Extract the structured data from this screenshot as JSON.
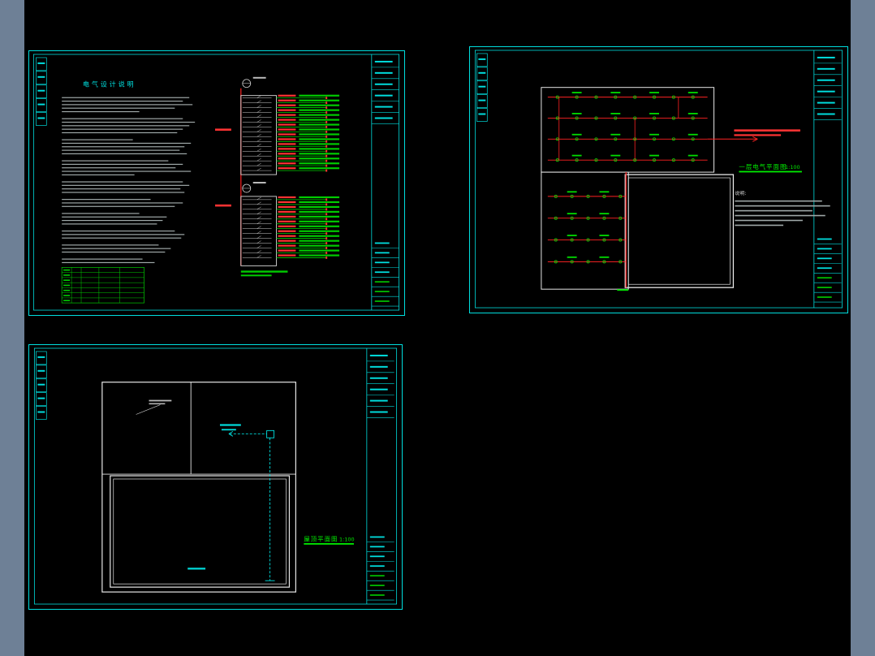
{
  "app": {
    "background": "#000000",
    "side_strip_color": "#6e8096"
  },
  "palette": {
    "frame_cyan": "#00dede",
    "wiring_red": "#ff2222",
    "fixture_green": "#00dd00",
    "wall_white": "#e8e8e8",
    "note_gray": "#9fa8a8"
  },
  "sheets": [
    {
      "id": "electrical-design-notes",
      "title": "电气设计说明"
    },
    {
      "id": "first-floor-electrical-plan",
      "title": "一层电气平面图",
      "scale": "1:100",
      "notes_header": "说明:"
    },
    {
      "id": "roof-plan",
      "title": "屋顶平面图",
      "scale": "1:100"
    }
  ]
}
